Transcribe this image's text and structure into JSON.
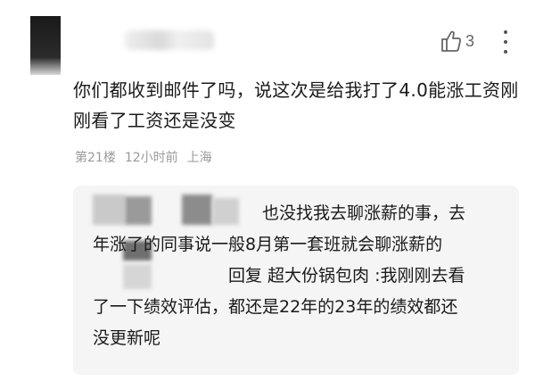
{
  "comment": {
    "like_count": "3",
    "text": "你们都收到邮件了吗，说这次是给我打了4.0能涨工资刚刚看了工资还是没变",
    "floor": "第21楼",
    "time": "12小时前",
    "location": "上海"
  },
  "reply": {
    "line1": "也没找我去聊涨薪的事，去",
    "line2": "年涨了的同事说一般8月第一套班就会聊涨薪的",
    "line3": "回复 超大份锅包肉 :我刚刚去看",
    "line4": "了一下绩效评估，都还是22年的23年的绩效都还",
    "line5": "没更新呢"
  },
  "icons": {
    "like": "thumbs-up-icon",
    "more": "more-vertical-icon"
  },
  "colors": {
    "text": "#1a1a1a",
    "meta": "#999999",
    "reply_bg": "#f5f5f5"
  }
}
